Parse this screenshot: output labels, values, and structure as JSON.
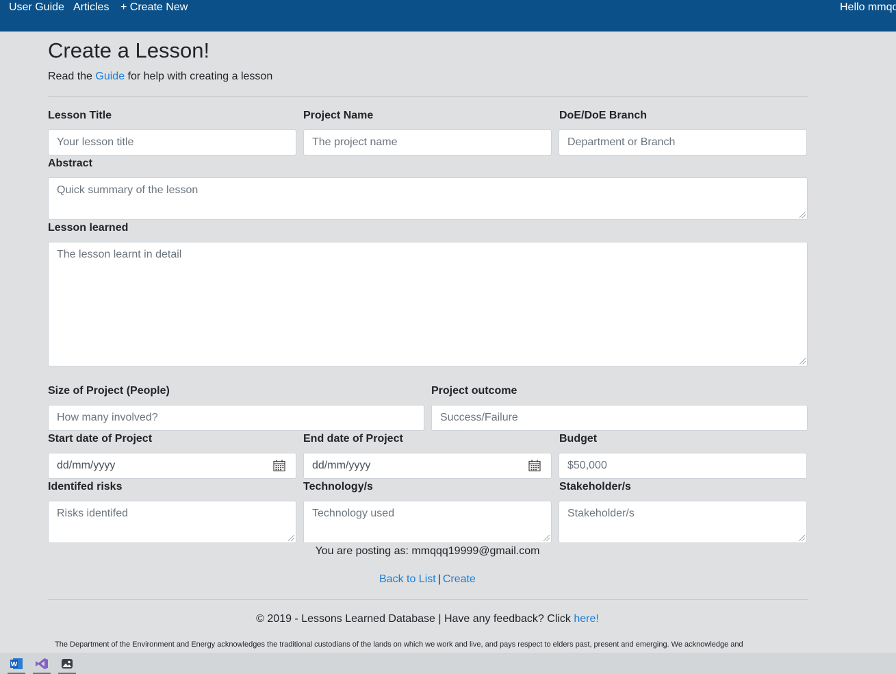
{
  "nav": {
    "user_guide": "User Guide",
    "articles": "Articles",
    "create_new": "+ Create New",
    "hello": "Hello mmqq"
  },
  "page": {
    "title": "Create a Lesson!",
    "subtitle_pre": "Read the ",
    "subtitle_link": "Guide",
    "subtitle_post": " for help with creating a lesson"
  },
  "form": {
    "lesson_title": {
      "label": "Lesson Title",
      "placeholder": "Your lesson title"
    },
    "project_name": {
      "label": "Project Name",
      "placeholder": "The project name"
    },
    "doe_branch": {
      "label": "DoE/DoE Branch",
      "placeholder": "Department or Branch"
    },
    "abstract": {
      "label": "Abstract",
      "placeholder": "Quick summary of the lesson"
    },
    "lesson_learned": {
      "label": "Lesson learned",
      "placeholder": "The lesson learnt in detail"
    },
    "size": {
      "label": "Size of Project (People)",
      "placeholder": "How many involved?"
    },
    "outcome": {
      "label": "Project outcome",
      "placeholder": "Success/Failure"
    },
    "start_date": {
      "label": "Start date of Project",
      "value": "dd/mm/yyyy"
    },
    "end_date": {
      "label": "End date of Project",
      "value": "dd/mm/yyyy"
    },
    "budget": {
      "label": "Budget",
      "placeholder": "$50,000"
    },
    "risks": {
      "label": "Identifed risks",
      "placeholder": "Risks identifed"
    },
    "technology": {
      "label": "Technology/s",
      "placeholder": "Technology used"
    },
    "stakeholders": {
      "label": "Stakeholder/s",
      "placeholder": "Stakeholder/s"
    }
  },
  "posting_as": "You are posting as: mmqqq19999@gmail.com",
  "actions": {
    "back": "Back to List",
    "separator": "|",
    "create": "Create"
  },
  "footer": {
    "copyright": "© 2019 - Lessons Learned Database | Have any feedback? Click ",
    "here": "here!",
    "acknowledgement": "The Department of the Environment and Energy acknowledges the traditional custodians of the lands on which we work and live, and pays respect to elders past, present and emerging. We acknowledge and"
  },
  "taskbar": [
    "word-icon",
    "visual-studio-icon",
    "photos-icon"
  ]
}
